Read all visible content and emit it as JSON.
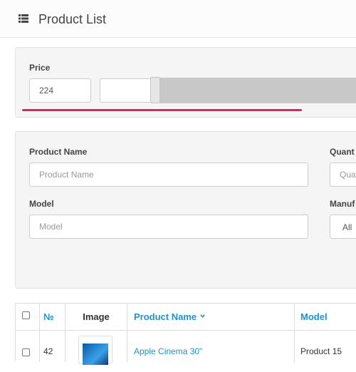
{
  "header": {
    "title": "Product List",
    "icon": "list-icon"
  },
  "price_filter": {
    "label": "Price",
    "min_value": "224",
    "max_value": ""
  },
  "filters": {
    "product_name_label": "Product Name",
    "product_name_placeholder": "Product Name",
    "quantity_label": "Quant",
    "quantity_placeholder": "Qua",
    "model_label": "Model",
    "model_placeholder": "Model",
    "manufacturer_label": "Manuf",
    "manufacturer_value": "All"
  },
  "table": {
    "headers": {
      "number": "№",
      "image": "Image",
      "product_name": "Product Name",
      "model": "Model"
    },
    "rows": [
      {
        "number": "42",
        "product_name": "Apple Cinema 30\"",
        "model": "Product 15"
      }
    ]
  },
  "colors": {
    "link": "#1e91cf",
    "underline": "#e0245e",
    "panel": "#f5f5f5"
  }
}
